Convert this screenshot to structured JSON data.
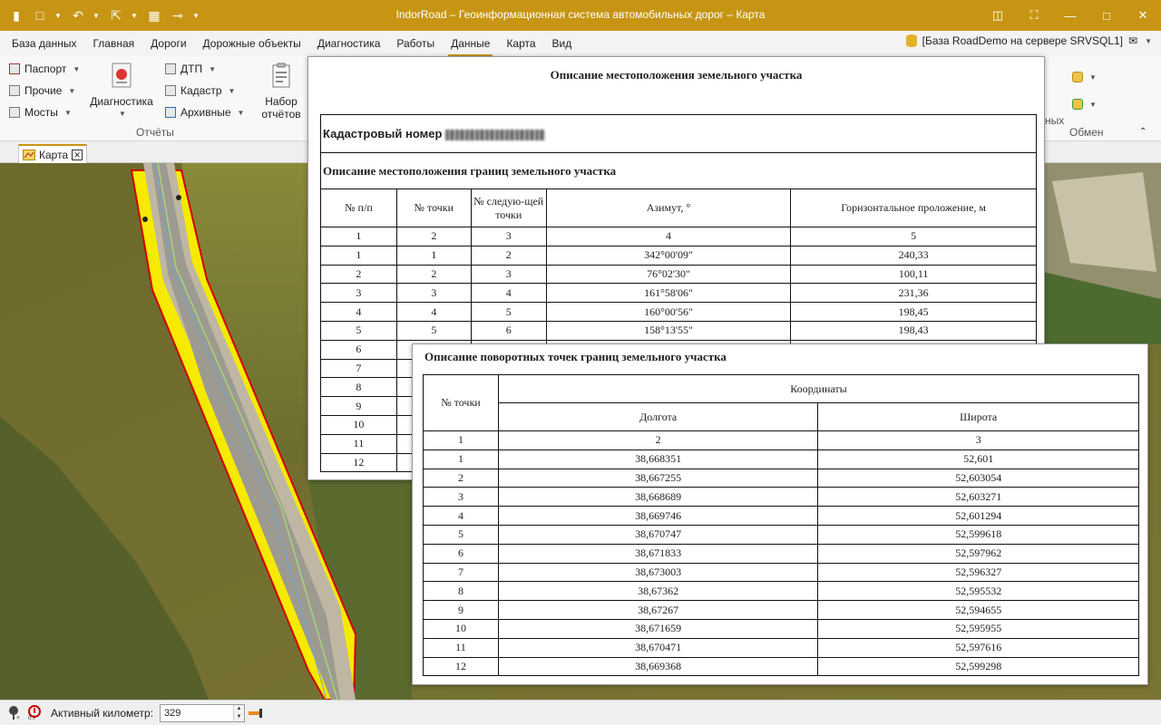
{
  "window": {
    "title": "IndorRoad – Геоинформационная система автомобильных дорог – Карта"
  },
  "menu": {
    "tabs": [
      "База данных",
      "Главная",
      "Дороги",
      "Дорожные объекты",
      "Диагностика",
      "Работы",
      "Данные",
      "Карта",
      "Вид"
    ],
    "active": "Данные",
    "db_label": "[База RoadDemo на сервере SRVSQL1]"
  },
  "ribbon": {
    "passport": "Паспорт",
    "other": "Прочие",
    "bridges": "Мосты",
    "diagnostics": "Диагностика",
    "dtp": "ДТП",
    "cadastre": "Кадастр",
    "archive": "Архивные",
    "reports_set_1": "Набор",
    "reports_set_2": "отчётов",
    "group_reports": "Отчёты",
    "group_exchange": "Обмен",
    "partial_text": "ных"
  },
  "doc_tab": {
    "label": "Карта"
  },
  "status": {
    "km_label": "Активный километр:",
    "km_value": "329"
  },
  "report1": {
    "title": "Описание местоположения земельного участка",
    "cadastral_label": "Кадастровый номер",
    "section_title": "Описание местоположения границ земельного участка",
    "headers": [
      "№ п/п",
      "№ точки",
      "№ следую-щей точки",
      "Азимут, °",
      "Горизонтальное проложение, м"
    ],
    "col_numbers": [
      "1",
      "2",
      "3",
      "4",
      "5"
    ],
    "rows": [
      [
        "1",
        "1",
        "2",
        "342°00'09\"",
        "240,33"
      ],
      [
        "2",
        "2",
        "3",
        "76°02'30\"",
        "100,11"
      ],
      [
        "3",
        "3",
        "4",
        "161°58'06\"",
        "231,36"
      ],
      [
        "4",
        "4",
        "5",
        "160°00'56\"",
        "198,45"
      ],
      [
        "5",
        "5",
        "6",
        "158°13'55\"",
        "198,43"
      ],
      [
        "6",
        "",
        "",
        "",
        ""
      ],
      [
        "7",
        "",
        "",
        "",
        ""
      ],
      [
        "8",
        "",
        "",
        "",
        ""
      ],
      [
        "9",
        "",
        "",
        "",
        ""
      ],
      [
        "10",
        "",
        "",
        "",
        ""
      ],
      [
        "11",
        "",
        "",
        "",
        ""
      ],
      [
        "12",
        "",
        "",
        "",
        ""
      ]
    ]
  },
  "report2": {
    "title": "Описание поворотных точек границ земельного участка",
    "col_point": "№ точки",
    "col_coords": "Координаты",
    "col_lon": "Долгота",
    "col_lat": "Широта",
    "col_numbers": [
      "1",
      "2",
      "3"
    ],
    "rows": [
      [
        "1",
        "38,668351",
        "52,601"
      ],
      [
        "2",
        "38,667255",
        "52,603054"
      ],
      [
        "3",
        "38,668689",
        "52,603271"
      ],
      [
        "4",
        "38,669746",
        "52,601294"
      ],
      [
        "5",
        "38,670747",
        "52,599618"
      ],
      [
        "6",
        "38,671833",
        "52,597962"
      ],
      [
        "7",
        "38,673003",
        "52,596327"
      ],
      [
        "8",
        "38,67362",
        "52,595532"
      ],
      [
        "9",
        "38,67267",
        "52,594655"
      ],
      [
        "10",
        "38,671659",
        "52,595955"
      ],
      [
        "11",
        "38,670471",
        "52,597616"
      ],
      [
        "12",
        "38,669368",
        "52,599298"
      ]
    ]
  },
  "colors": {
    "accent": "#c79513",
    "road_buffer": "#f5ea00",
    "boundary": "#d00000"
  }
}
